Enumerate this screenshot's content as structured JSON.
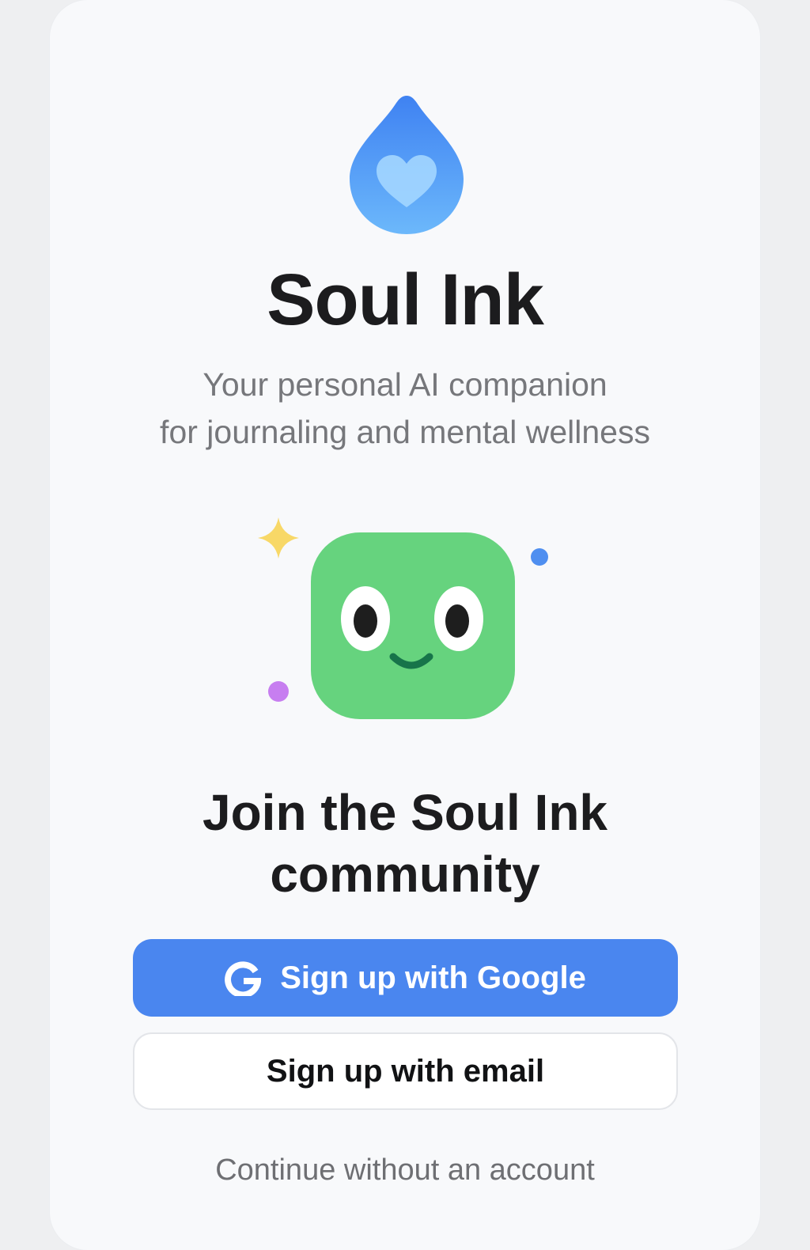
{
  "app": {
    "title": "Soul Ink",
    "tagline_line1": "Your personal AI companion",
    "tagline_line2": "for journaling and mental wellness",
    "logo_icon": "water-drop-heart-icon",
    "mascot_icon": "smiling-green-square-mascot"
  },
  "signup": {
    "heading_line1": "Join the Soul Ink",
    "heading_line2": "community",
    "google_button_label": "Sign up with Google",
    "google_icon": "google-g-icon",
    "email_button_label": "Sign up with email",
    "skip_link_label": "Continue without an account"
  },
  "colors": {
    "primary": "#4a86ef",
    "mascot_green": "#66d37e",
    "text_dark": "#1c1c1e",
    "text_muted": "#76777b",
    "background": "#f8f9fb"
  }
}
